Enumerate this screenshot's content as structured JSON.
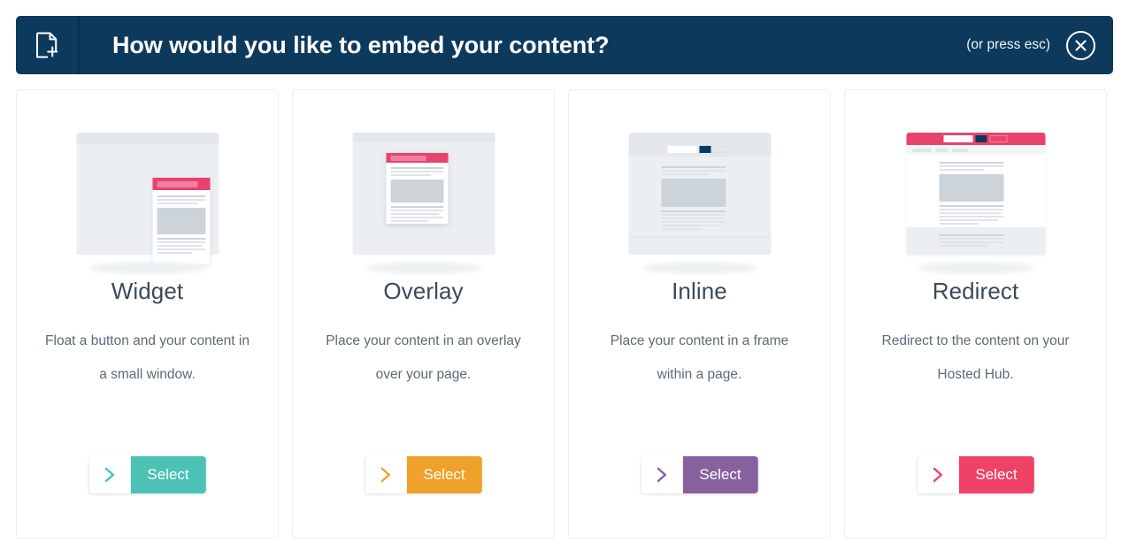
{
  "header": {
    "icon": "document-add-icon",
    "title": "How would you like to embed your content?",
    "esc_hint": "(or press esc)",
    "close_icon": "close-circle-icon",
    "bg_color": "#0d3a5c"
  },
  "cards": [
    {
      "id": "widget",
      "illustration": "widget-popup-illustration",
      "title": "Widget",
      "description": "Float a button and your content in a small window.",
      "select_label": "Select",
      "chevron_icon": "chevron-right-icon",
      "accent_color": "#4cc2b4"
    },
    {
      "id": "overlay",
      "illustration": "overlay-modal-illustration",
      "title": "Overlay",
      "description": "Place your content in an overlay over your page.",
      "select_label": "Select",
      "chevron_icon": "chevron-right-icon",
      "accent_color": "#efa12c"
    },
    {
      "id": "inline",
      "illustration": "inline-frame-illustration",
      "title": "Inline",
      "description": "Place your content in a frame within a page.",
      "select_label": "Select",
      "chevron_icon": "chevron-right-icon",
      "accent_color": "#87619f"
    },
    {
      "id": "redirect",
      "illustration": "redirect-hosted-page-illustration",
      "title": "Redirect",
      "description": "Redirect to the content on your Hosted Hub.",
      "select_label": "Select",
      "chevron_icon": "chevron-right-icon",
      "accent_color": "#ee4267"
    }
  ]
}
